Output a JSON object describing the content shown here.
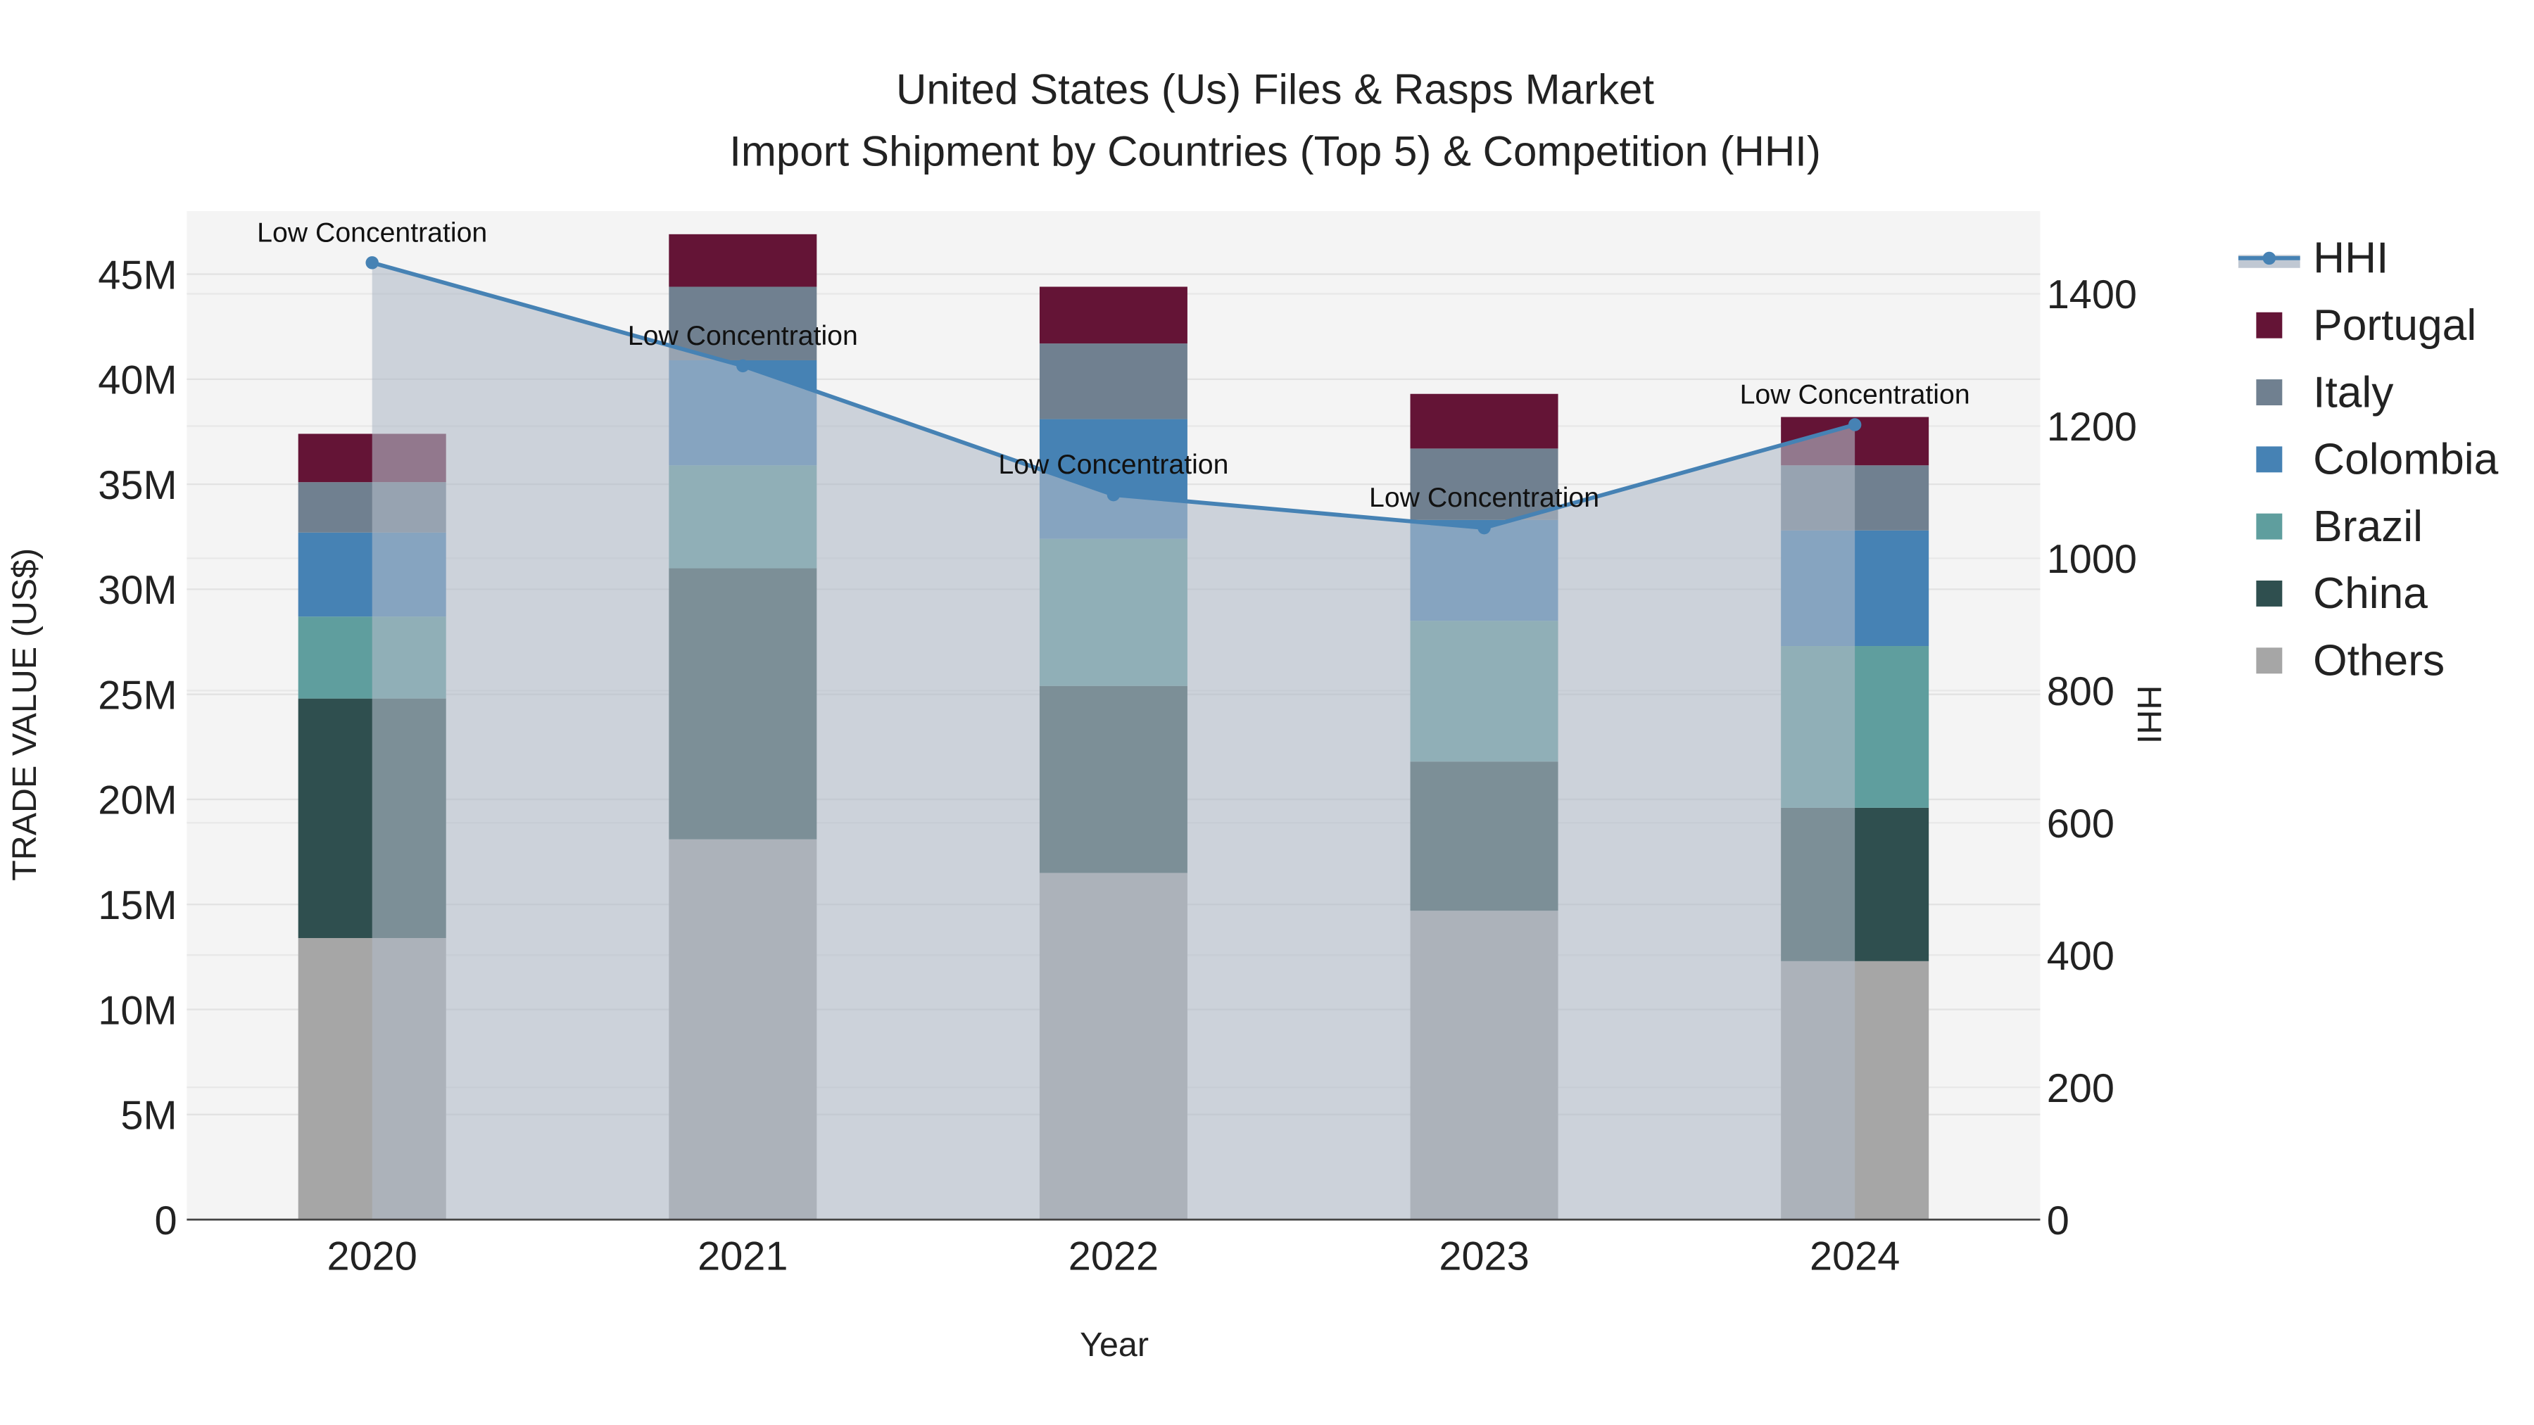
{
  "chart_data": {
    "type": "bar",
    "title_line1": "United States (Us) Files & Rasps Market",
    "title_line2": "Import Shipment by Countries (Top 5) & Competition (HHI)",
    "xlabel": "Year",
    "ylabel": "TRADE VALUE (US$)",
    "y2label": "HHI",
    "categories": [
      "2020",
      "2021",
      "2022",
      "2023",
      "2024"
    ],
    "ylim": [
      0,
      48
    ],
    "y2lim": [
      0,
      1525
    ],
    "yticks": [
      0,
      5,
      10,
      15,
      20,
      25,
      30,
      35,
      40,
      45
    ],
    "ytick_labels": [
      "0",
      "5M",
      "10M",
      "15M",
      "20M",
      "25M",
      "30M",
      "35M",
      "40M",
      "45M"
    ],
    "y2ticks": [
      0,
      200,
      400,
      600,
      800,
      1000,
      1200,
      1400
    ],
    "y2tick_labels": [
      "0",
      "200",
      "400",
      "600",
      "800",
      "1000",
      "1200",
      "1400"
    ],
    "unit": "millions US$",
    "series": [
      {
        "name": "Others",
        "color": "#a6a6a6",
        "values": [
          13.4,
          18.1,
          16.5,
          14.7,
          12.3
        ]
      },
      {
        "name": "China",
        "color": "#2f4f4f",
        "values": [
          11.4,
          12.9,
          8.9,
          7.1,
          7.3
        ]
      },
      {
        "name": "Brazil",
        "color": "#5f9e9e",
        "values": [
          3.9,
          4.9,
          7.0,
          6.7,
          7.7
        ]
      },
      {
        "name": "Colombia",
        "color": "#4682b4",
        "values": [
          4.0,
          5.0,
          5.7,
          4.8,
          5.5
        ]
      },
      {
        "name": "Italy",
        "color": "#708090",
        "values": [
          2.4,
          3.5,
          3.6,
          3.4,
          3.1
        ]
      },
      {
        "name": "Portugal",
        "color": "#641436",
        "values": [
          2.3,
          2.5,
          2.7,
          2.6,
          2.3
        ]
      }
    ],
    "hhi": {
      "name": "HHI",
      "color": "#4682b4",
      "values": [
        1447,
        1291,
        1096,
        1046,
        1202
      ],
      "annotations": [
        "Low Concentration",
        "Low Concentration",
        "Low Concentration",
        "Low Concentration",
        "Low Concentration"
      ]
    },
    "legend_position": "right",
    "legend_order": [
      "HHI",
      "Portugal",
      "Italy",
      "Colombia",
      "Brazil",
      "China",
      "Others"
    ],
    "grid": true
  }
}
